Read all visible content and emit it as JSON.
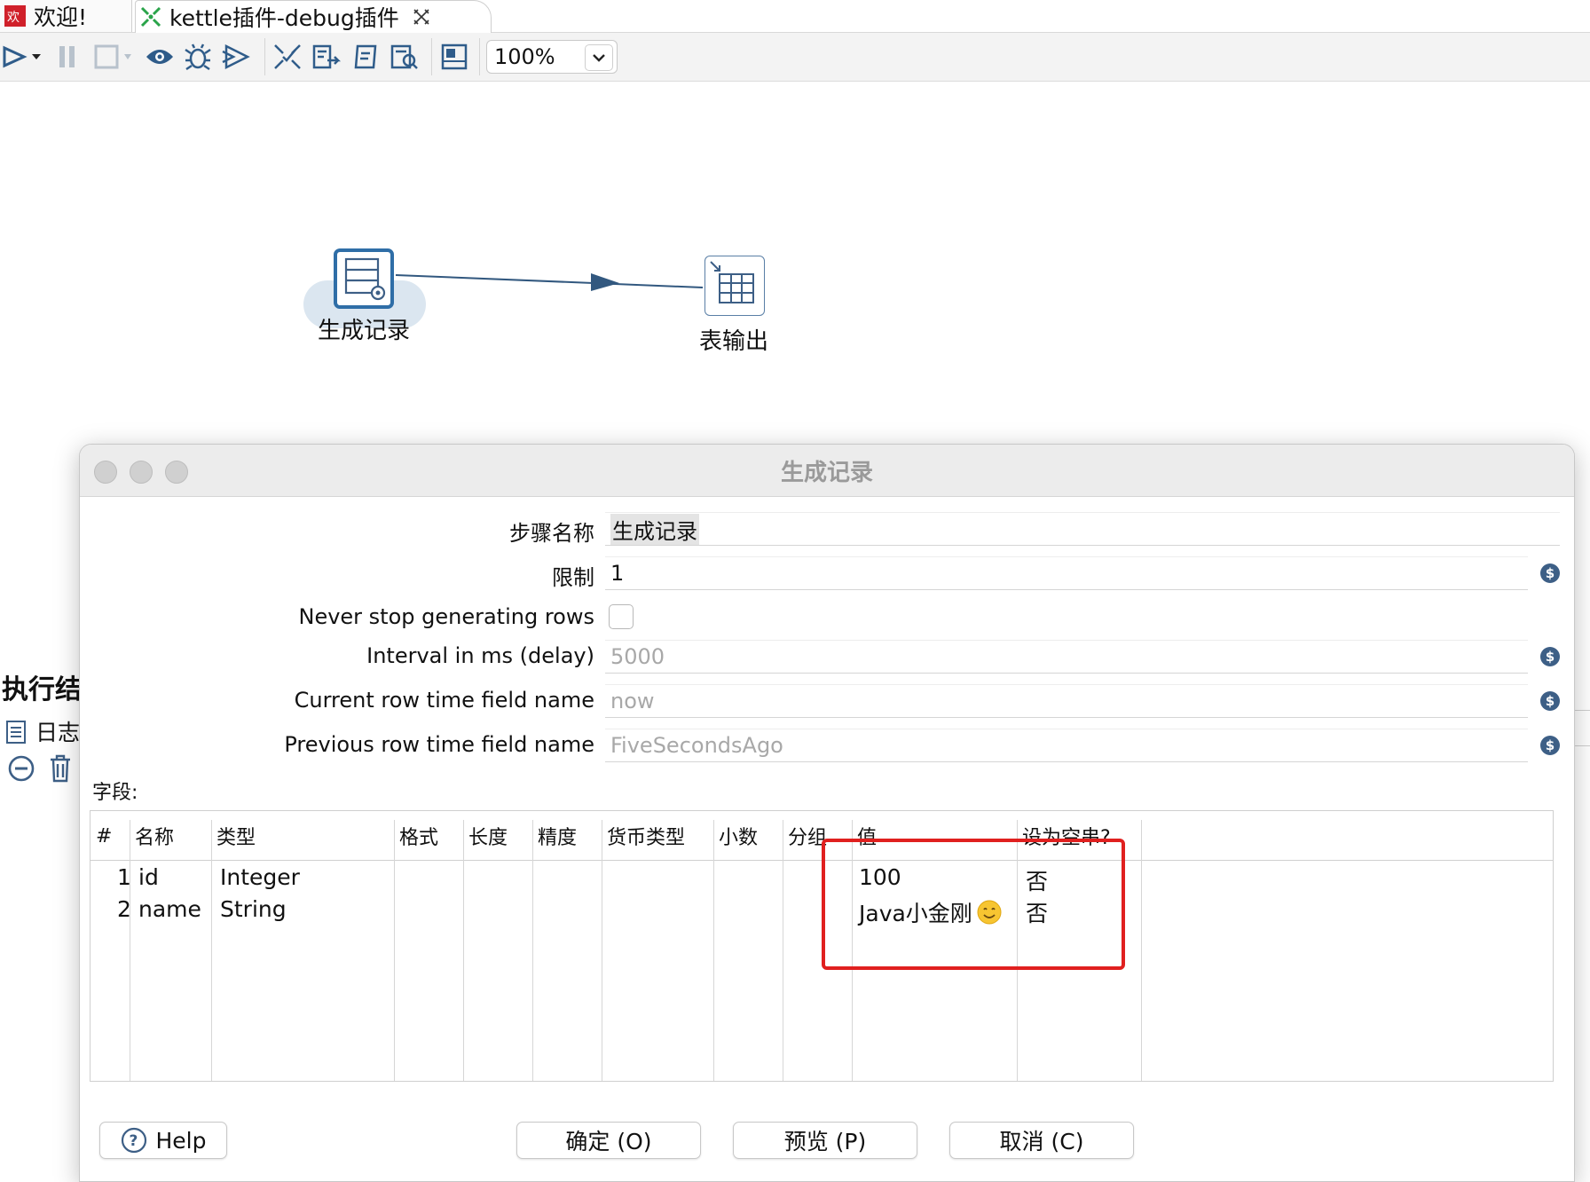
{
  "tabs": [
    {
      "label": "欢迎!",
      "icon": "welcome-icon"
    },
    {
      "label": "kettle插件-debug插件",
      "icon": "transformation-icon",
      "close_icon": "close-tab-icon"
    }
  ],
  "toolbar": {
    "icons": [
      "run-icon",
      "run-dropdown-icon",
      "pause-icon",
      "stop-icon",
      "stop-dropdown-icon",
      "preview-icon",
      "debug-icon",
      "replay-icon",
      "verify-icon",
      "analyze-impact-icon",
      "sql-icon",
      "explore-db-icon",
      "show-results-icon"
    ],
    "zoom": "100%"
  },
  "canvas": {
    "steps": [
      {
        "label": "生成记录",
        "icon": "generate-rows-icon"
      },
      {
        "label": "表输出",
        "icon": "table-output-icon"
      }
    ],
    "hop": "arrow-icon"
  },
  "background_panel": {
    "title": "执行结",
    "tab_label": "日志"
  },
  "dialog": {
    "title": "生成记录",
    "fields": {
      "step_name_label": "步骤名称",
      "step_name_value": "生成记录",
      "limit_label": "限制",
      "limit_value": "1",
      "never_stop_label": "Never stop generating rows",
      "interval_label": "Interval in ms (delay)",
      "interval_value": "5000",
      "current_row_label": "Current row time field name",
      "current_row_value": "now",
      "previous_row_label": "Previous row time field name",
      "previous_row_value": "FiveSecondsAgo"
    },
    "fields_section_label": "字段:",
    "table": {
      "headers": [
        "#",
        "名称",
        "类型",
        "格式",
        "长度",
        "精度",
        "货币类型",
        "小数",
        "分组",
        "值",
        "设为空串?"
      ],
      "rows": [
        {
          "num": "1",
          "name": "id",
          "type": "Integer",
          "value": "100",
          "empty": "否"
        },
        {
          "num": "2",
          "name": "name",
          "type": "String",
          "value": "Java小金刚",
          "empty": "否"
        }
      ],
      "highlight_color": "#e0201f"
    },
    "buttons": {
      "help": "Help",
      "ok": "确定 (O)",
      "preview": "预览 (P)",
      "cancel": "取消 (C)"
    }
  }
}
